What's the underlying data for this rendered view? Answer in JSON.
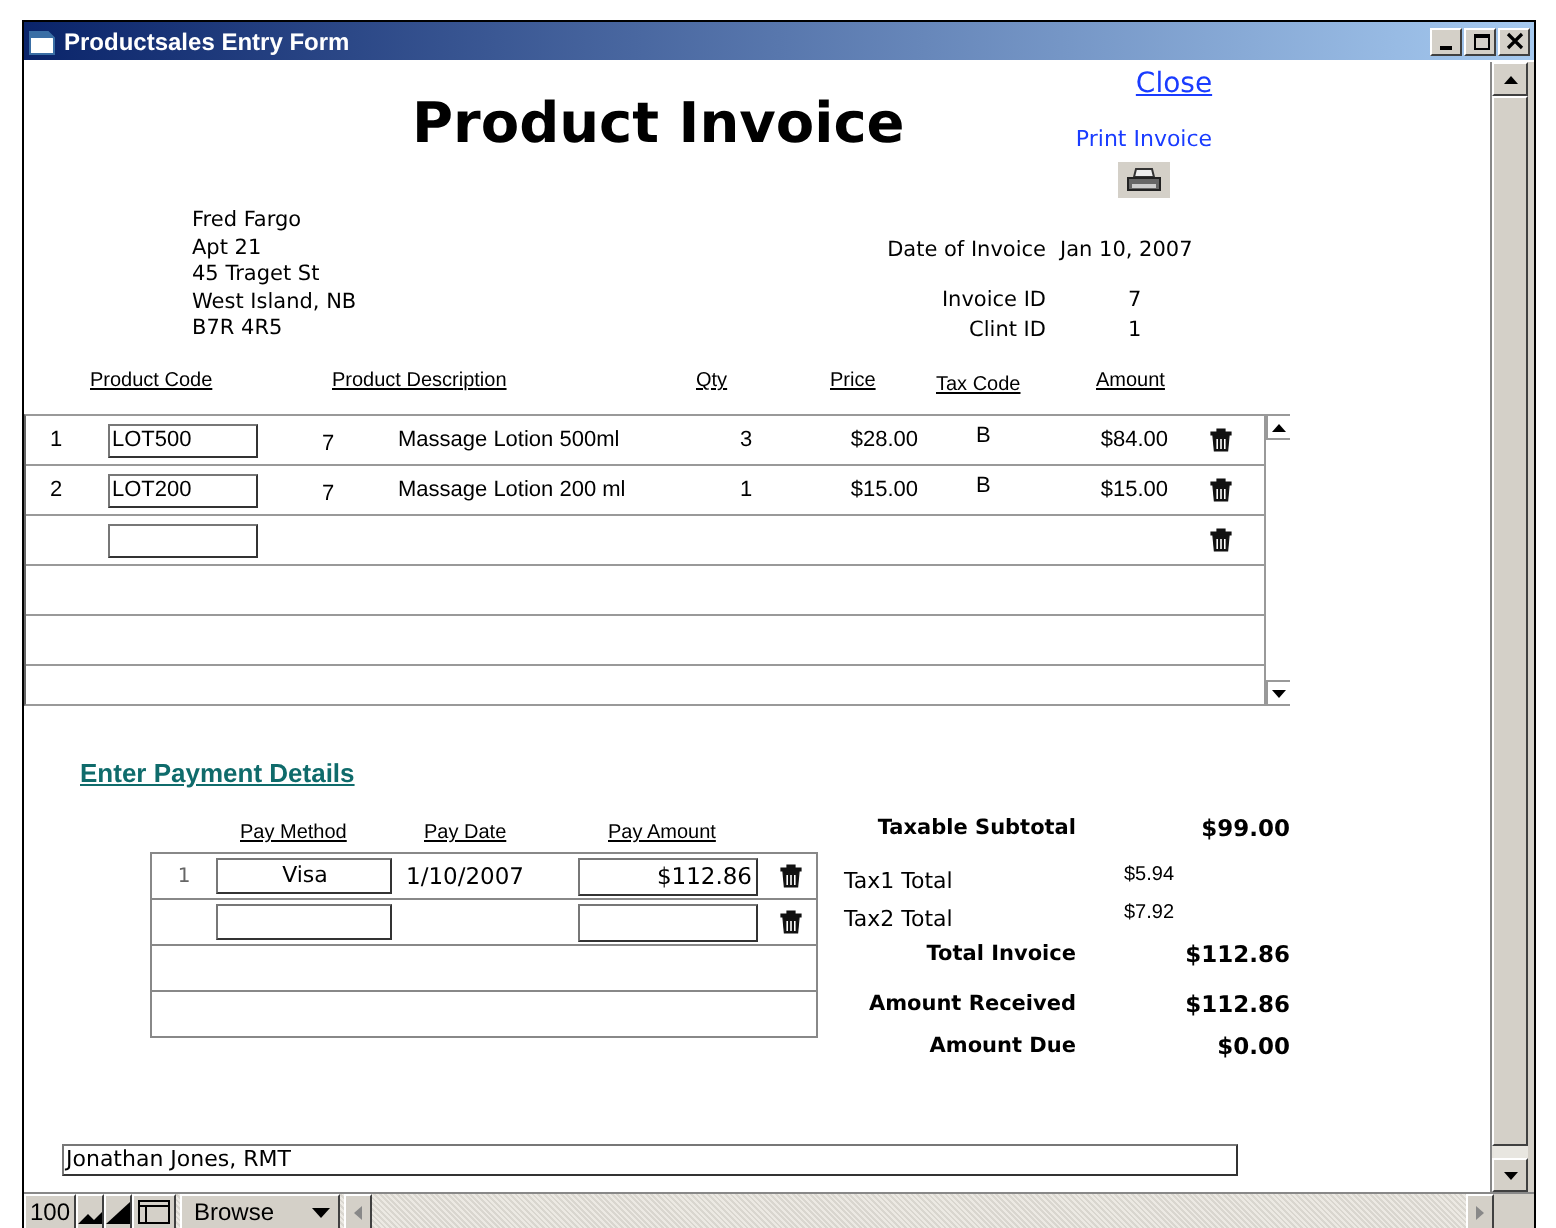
{
  "window": {
    "title": "Productsales Entry Form"
  },
  "header": {
    "title": "Product Invoice",
    "close_link": "Close",
    "print_link": "Print Invoice"
  },
  "address": [
    "Fred Fargo",
    "Apt 21",
    "45 Traget St",
    "West Island, NB",
    "B7R 4R5"
  ],
  "invoice_info": [
    {
      "label": "Date of Invoice",
      "value": "Jan 10, 2007"
    },
    {
      "label": "Invoice ID",
      "value": "7"
    },
    {
      "label": "Clint ID",
      "value": "1"
    }
  ],
  "line_items": {
    "columns": [
      "Product Code",
      "Product Description",
      "Qty",
      "Price",
      "Tax Code",
      "Amount"
    ],
    "rows": [
      {
        "kind": "item",
        "number": "1",
        "product_code": "LOT500",
        "column_3": "7",
        "description": "Massage Lotion 500ml",
        "qty": "3",
        "price": "$28.00",
        "tax_code": "B",
        "amount": "$84.00"
      },
      {
        "kind": "item",
        "number": "2",
        "product_code": "LOT200",
        "column_3": "7",
        "description": "Massage Lotion 200 ml",
        "qty": "1",
        "price": "$15.00",
        "tax_code": "B",
        "amount": "$15.00"
      },
      {
        "kind": "entry"
      },
      {
        "kind": "empty"
      },
      {
        "kind": "empty"
      },
      {
        "kind": "empty"
      }
    ]
  },
  "payments": {
    "title": "Enter Payment Details",
    "columns": [
      "Pay Method",
      "Pay Date",
      "Pay Amount"
    ],
    "rows": [
      {
        "kind": "item",
        "number": "1",
        "pay_method": "Visa",
        "pay_date": "1/10/2007",
        "pay_amount": "$112.86"
      },
      {
        "kind": "entry"
      },
      {
        "kind": "empty"
      },
      {
        "kind": "empty"
      }
    ]
  },
  "totals": [
    {
      "kind": "bold",
      "label": "Taxable Subtotal",
      "value": "$99.00"
    },
    {
      "kind": "plain",
      "label": "Tax1 Total",
      "value": "$5.94"
    },
    {
      "kind": "plain",
      "label": "Tax2 Total",
      "value": "$7.92"
    },
    {
      "kind": "bold",
      "label": "Total Invoice",
      "value": "$112.86"
    },
    {
      "kind": "bold",
      "label": "Amount Received",
      "value": "$112.86"
    },
    {
      "kind": "bold",
      "label": "Amount Due",
      "value": "$0.00"
    }
  ],
  "footer_field": {
    "value": "Jonathan Jones, RMT"
  },
  "status_bar": {
    "zoom": "100",
    "mode": "Browse"
  }
}
